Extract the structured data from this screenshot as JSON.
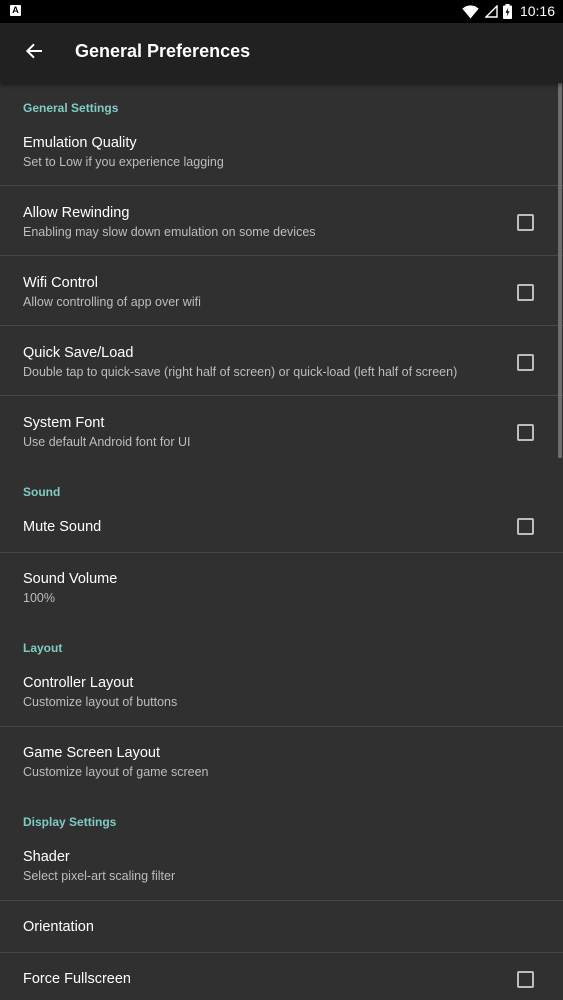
{
  "status_bar": {
    "notification_icon_label": "A",
    "time": "10:16",
    "wifi_icon": "wifi-icon",
    "battery_icon": "battery-charging-icon"
  },
  "app_bar": {
    "back_icon": "arrow-back-icon",
    "title": "General Preferences"
  },
  "sections": [
    {
      "header": "General Settings",
      "items": [
        {
          "title": "Emulation Quality",
          "summary": "Set to Low if you experience lagging"
        },
        {
          "title": "Allow Rewinding",
          "summary": "Enabling may slow down emulation on some devices",
          "checked": false
        },
        {
          "title": "Wifi Control",
          "summary": "Allow controlling of app over wifi",
          "checked": false
        },
        {
          "title": "Quick Save/Load",
          "summary": "Double tap to quick-save (right half of screen) or quick-load (left half of screen)",
          "checked": false
        },
        {
          "title": "System Font",
          "summary": "Use default Android font for UI",
          "checked": false
        }
      ]
    },
    {
      "header": "Sound",
      "items": [
        {
          "title": "Mute Sound",
          "checked": false
        },
        {
          "title": "Sound Volume",
          "summary": "100%"
        }
      ]
    },
    {
      "header": "Layout",
      "items": [
        {
          "title": "Controller Layout",
          "summary": "Customize layout of buttons"
        },
        {
          "title": "Game Screen Layout",
          "summary": "Customize layout of game screen"
        }
      ]
    },
    {
      "header": "Display Settings",
      "items": [
        {
          "title": "Shader",
          "summary": "Select pixel-art scaling filter"
        },
        {
          "title": "Orientation"
        },
        {
          "title": "Force Fullscreen",
          "checked": false
        }
      ]
    }
  ],
  "colors": {
    "background": "#303030",
    "app_bar": "#212121",
    "accent": "#80cbc4",
    "divider": "#474747",
    "summary_text": "#bdbdbd"
  }
}
